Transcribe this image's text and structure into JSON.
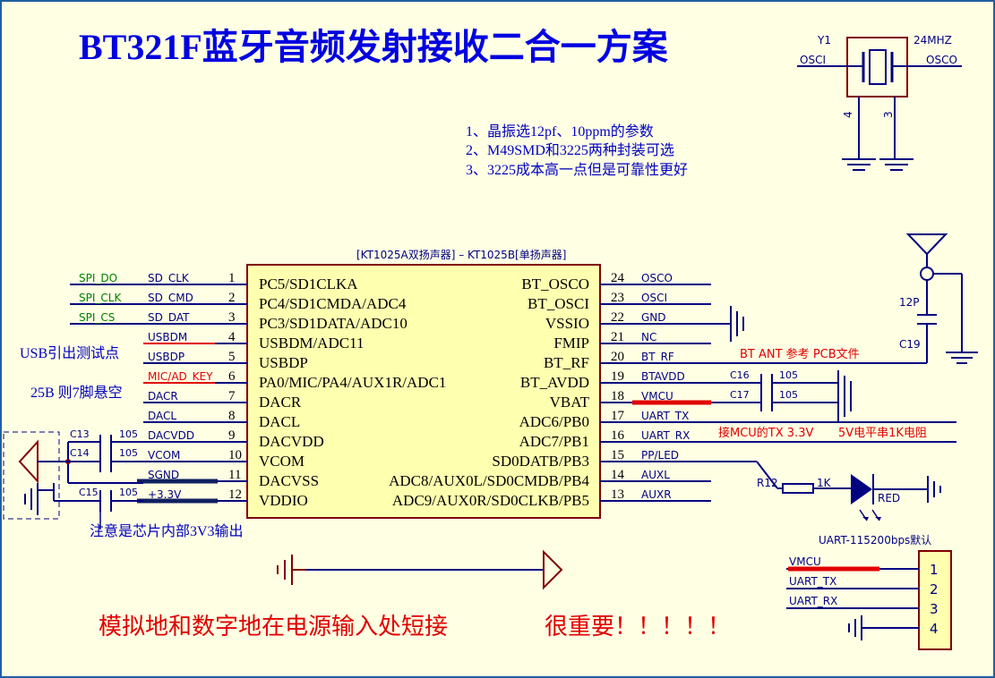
{
  "title": "BT321F蓝牙音频发射接收二合一方案",
  "notes": [
    "1、晶振选12pf、10ppm的参数",
    "2、M49SMD和3225两种封装可选",
    "3、3225成本高一点但是可靠性更好"
  ],
  "chip_caption": "[KT1025A双扬声器] – KT1025B[单扬声器]",
  "left_pins": [
    {
      "num": "1",
      "pin": "PC5/SD1CLKA",
      "net": "SD_CLK",
      "ext": "SPI_DO"
    },
    {
      "num": "2",
      "pin": "PC4/SD1CMDA/ADC4",
      "net": "SD_CMD",
      "ext": "SPI_CLK"
    },
    {
      "num": "3",
      "pin": "PC3/SD1DATA/ADC10",
      "net": "SD_DAT",
      "ext": "SPI_CS"
    },
    {
      "num": "4",
      "pin": "USBDM/ADC11",
      "net": "USBDM",
      "ext": ""
    },
    {
      "num": "5",
      "pin": "USBDP",
      "net": "USBDP",
      "ext": ""
    },
    {
      "num": "6",
      "pin": "PA0/MIC/PA4/AUX1R/ADC1",
      "net": "MIC/AD_KEY",
      "ext": ""
    },
    {
      "num": "7",
      "pin": "DACR",
      "net": "DACR",
      "ext": ""
    },
    {
      "num": "8",
      "pin": "DACL",
      "net": "DACL",
      "ext": ""
    },
    {
      "num": "9",
      "pin": "DACVDD",
      "net": "DACVDD",
      "ext": ""
    },
    {
      "num": "10",
      "pin": "VCOM",
      "net": "VCOM",
      "ext": ""
    },
    {
      "num": "11",
      "pin": "DACVSS",
      "net": "SGND",
      "ext": ""
    },
    {
      "num": "12",
      "pin": "VDDIO",
      "net": "+3.3V",
      "ext": ""
    }
  ],
  "right_pins": [
    {
      "num": "24",
      "pin": "BT_OSCO",
      "net": "OSCO"
    },
    {
      "num": "23",
      "pin": "BT_OSCI",
      "net": "OSCI"
    },
    {
      "num": "22",
      "pin": "VSSIO",
      "net": "GND"
    },
    {
      "num": "21",
      "pin": "FMIP",
      "net": "NC"
    },
    {
      "num": "20",
      "pin": "BT_RF",
      "net": "BT_RF"
    },
    {
      "num": "19",
      "pin": "BT_AVDD",
      "net": "BTAVDD"
    },
    {
      "num": "18",
      "pin": "VBAT",
      "net": "VMCU"
    },
    {
      "num": "17",
      "pin": "ADC6/PB0",
      "net": "UART_TX"
    },
    {
      "num": "16",
      "pin": "ADC7/PB1",
      "net": "UART_RX"
    },
    {
      "num": "15",
      "pin": "SD0DATB/PB3",
      "net": "PP/LED"
    },
    {
      "num": "14",
      "pin": "ADC8/AUX0L/SD0CMDB/PB4",
      "net": "AUXL"
    },
    {
      "num": "13",
      "pin": "ADC9/AUX0R/SD0CLKB/PB5",
      "net": "AUXR"
    }
  ],
  "crystal": {
    "ref": "Y1",
    "freq": "24MHZ",
    "osci": "OSCI",
    "osco": "OSCO",
    "pin4": "4",
    "pin3": "3"
  },
  "antenna": {
    "cap": "12P",
    "ref": "C19",
    "note": "BT ANT 参考 PCB文件"
  },
  "caps": {
    "c16": "C16",
    "c16v": "105",
    "c17": "C17",
    "c17v": "105",
    "c13": "C13",
    "c13v": "105",
    "c14": "C14",
    "c14v": "105",
    "c15": "C15",
    "c15v": "105"
  },
  "annotations": {
    "usb": "USB引出测试点",
    "pin7": "25B 则7脚悬空",
    "pin12": "注意是芯片内部3V3输出",
    "uart_note1": "接MCU的TX 3.3V",
    "uart_note2": "5V电平串1K电阻",
    "ground": "模拟地和数字地在电源输入处短接",
    "important": "很重要！！！！！"
  },
  "led": {
    "res": "R12",
    "val": "1K",
    "color": "RED"
  },
  "uart_header": {
    "title": "UART-115200bps默认",
    "rows": [
      {
        "net": "VMCU",
        "num": "1"
      },
      {
        "net": "UART_TX",
        "num": "2"
      },
      {
        "net": "UART_RX",
        "num": "3"
      },
      {
        "net": "",
        "num": "4"
      }
    ]
  },
  "colors": {
    "wire": "#000080",
    "body": "#FFFFB0",
    "border": "#800000",
    "pin_net": "#000080",
    "spi": "#008000",
    "red": "#E00000",
    "bg": "#FFFFE4"
  }
}
